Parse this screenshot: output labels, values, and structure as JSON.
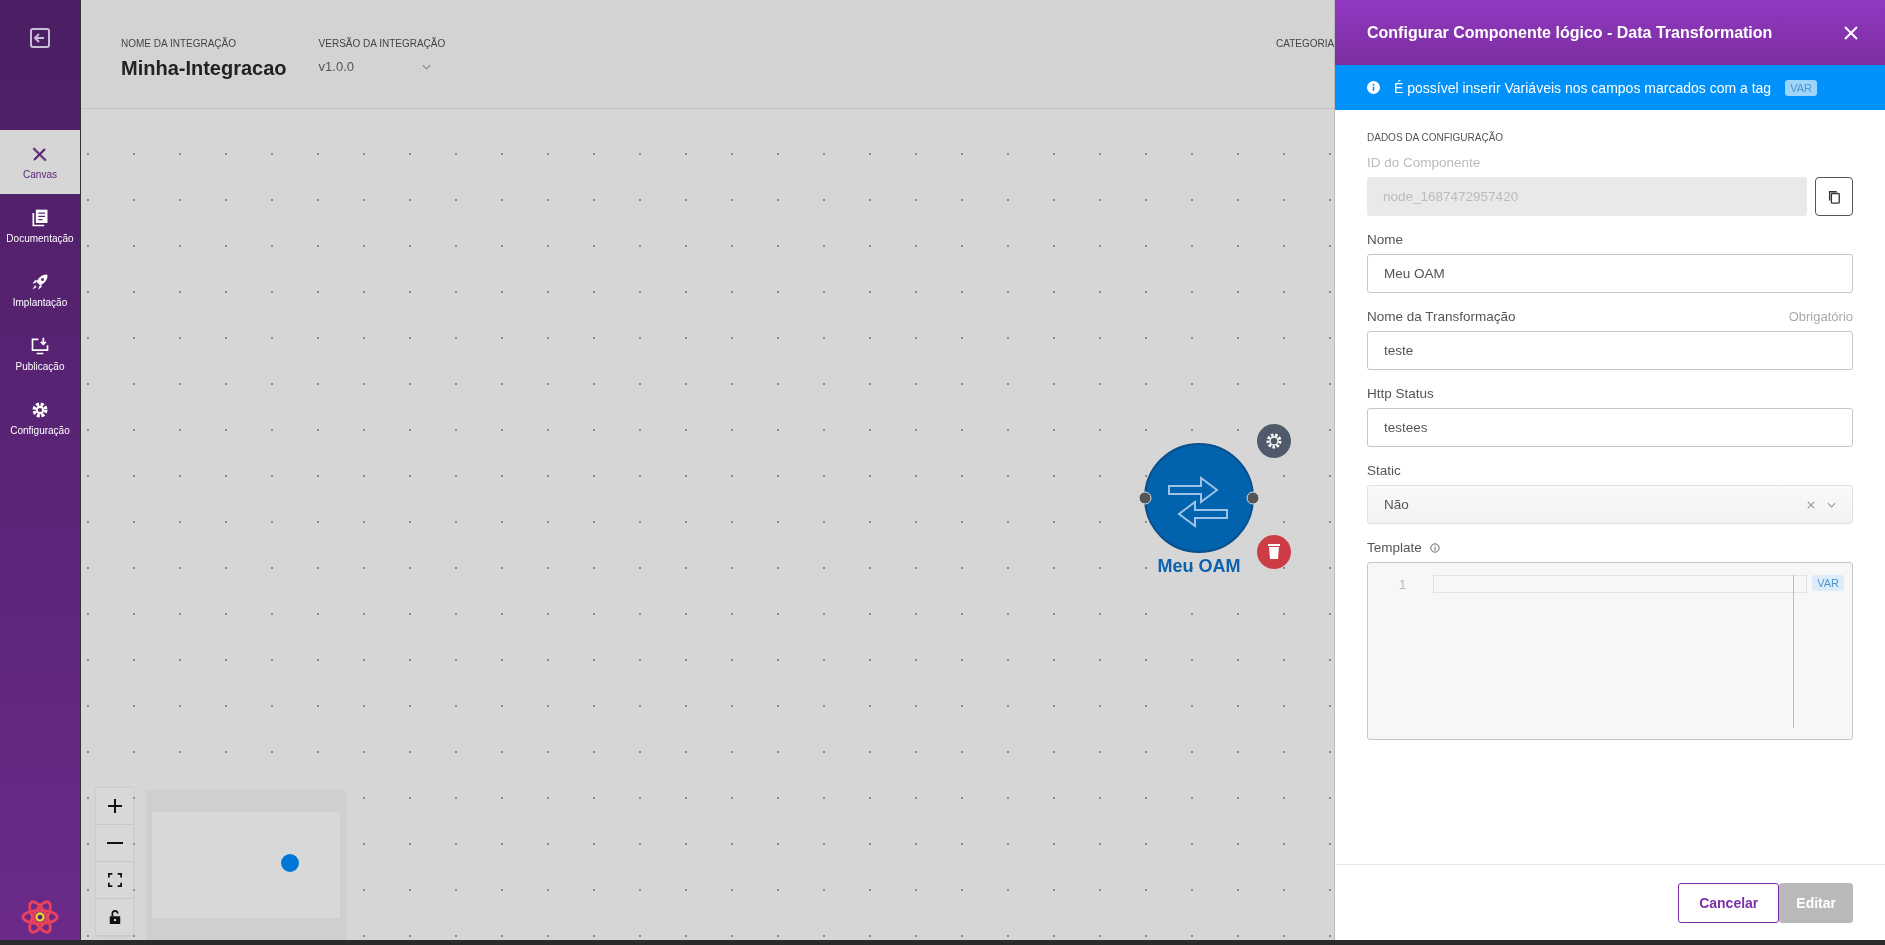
{
  "sidebar": {
    "items": [
      {
        "kind": "tools",
        "label": "Canvas",
        "selected": true
      },
      {
        "kind": "docs",
        "label": "Documentação",
        "selected": false
      },
      {
        "kind": "rocket",
        "label": "Implantação",
        "selected": false
      },
      {
        "kind": "download",
        "label": "Publicação",
        "selected": false
      },
      {
        "kind": "gear",
        "label": "Configuração",
        "selected": false
      }
    ]
  },
  "header": {
    "name_label": "NOME DA INTEGRAÇÃO",
    "name": "Minha-Integracao",
    "version_label": "VERSÃO DA INTEGRAÇÃO",
    "version": "v1.0.0",
    "category_label": "CATEGORIA"
  },
  "canvas": {
    "node": {
      "label": "Meu OAM"
    }
  },
  "panel": {
    "title": "Configurar Componente lógico - Data Transformation",
    "info": "É possível inserir Variáveis nos campos marcados com a tag",
    "info_tag": "VAR",
    "section": "DADOS DA CONFIGURAÇÃO",
    "fields": [
      {
        "kind": "readonly",
        "label": "ID do Componente",
        "value": "node_1687472957420"
      },
      {
        "kind": "text",
        "label": "Nome",
        "value": "Meu OAM"
      },
      {
        "kind": "text",
        "label": "Nome da Transformação",
        "hint": "Obrigatório",
        "value": "teste"
      },
      {
        "kind": "text",
        "label": "Http Status",
        "value": "testees"
      },
      {
        "kind": "select",
        "label": "Static",
        "value": "Não"
      },
      {
        "kind": "code",
        "label": "Template",
        "line_number": "1",
        "tag": "VAR"
      }
    ],
    "buttons": [
      {
        "label": "Cancelar",
        "disabled": false
      },
      {
        "label": "Editar",
        "disabled": true
      }
    ]
  }
}
